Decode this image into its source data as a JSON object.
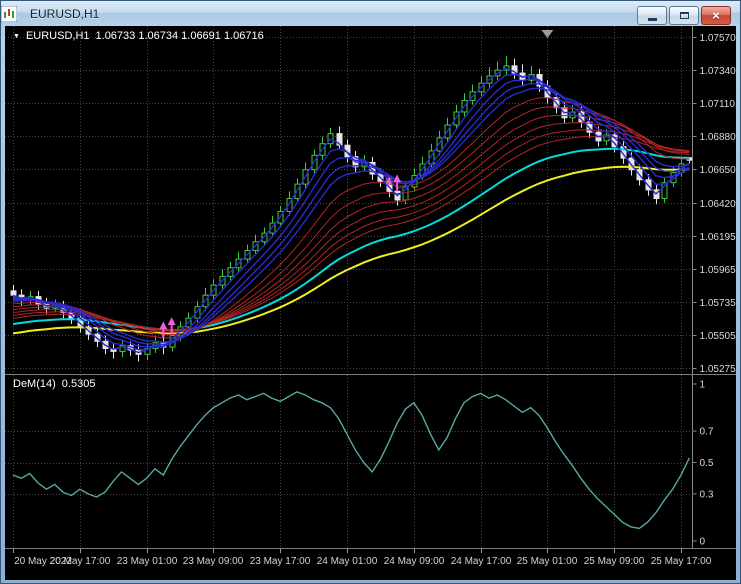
{
  "window": {
    "title": "EURUSD,H1"
  },
  "chart_data": {
    "type": "candlestick",
    "symbol_timeframe_label": "EURUSD,H1",
    "ohlc_label": "1.06733 1.06734 1.06691 1.06716",
    "background": "#000000",
    "grid_color": "#454545",
    "bull_color": "#3ecb3e",
    "bear_color": "#e6e6e6",
    "shift_marker_index": 64,
    "price_axis": {
      "top_value": 1.0757,
      "bottom_value": 1.05275,
      "ticks": [
        "1.07570",
        "1.07340",
        "1.07110",
        "1.06880",
        "1.06650",
        "1.06420",
        "1.06195",
        "1.05965",
        "1.05735",
        "1.05505",
        "1.05275"
      ]
    },
    "time_axis": {
      "candles_per_label": 8,
      "labels": [
        "20 May 2022",
        "20 May 17:00",
        "23 May 01:00",
        "23 May 09:00",
        "23 May 17:00",
        "24 May 01:00",
        "24 May 09:00",
        "24 May 17:00",
        "25 May 01:00",
        "25 May 09:00",
        "25 May 17:00"
      ]
    },
    "candles": [
      [
        1.0581,
        1.0585,
        1.0574,
        1.0578
      ],
      [
        1.0578,
        1.0582,
        1.0571,
        1.0575
      ],
      [
        1.0575,
        1.0581,
        1.0571,
        1.0577
      ],
      [
        1.0577,
        1.0581,
        1.0568,
        1.0572
      ],
      [
        1.0572,
        1.0576,
        1.0565,
        1.0569
      ],
      [
        1.0569,
        1.0575,
        1.0566,
        1.0571
      ],
      [
        1.0571,
        1.0574,
        1.0562,
        1.0566
      ],
      [
        1.0566,
        1.057,
        1.0558,
        1.0562
      ],
      [
        1.0562,
        1.0565,
        1.0552,
        1.0556
      ],
      [
        1.0556,
        1.056,
        1.0547,
        1.0551
      ],
      [
        1.0551,
        1.0555,
        1.0542,
        1.0546
      ],
      [
        1.0546,
        1.055,
        1.0537,
        1.0541
      ],
      [
        1.0541,
        1.0545,
        1.0534,
        1.0539
      ],
      [
        1.0539,
        1.0547,
        1.0535,
        1.0543
      ],
      [
        1.0543,
        1.0546,
        1.0536,
        1.054
      ],
      [
        1.054,
        1.0544,
        1.0532,
        1.0537
      ],
      [
        1.0537,
        1.0545,
        1.0533,
        1.0541
      ],
      [
        1.0541,
        1.055,
        1.0538,
        1.0545
      ],
      [
        1.0545,
        1.0548,
        1.0537,
        1.0542
      ],
      [
        1.0542,
        1.0554,
        1.0539,
        1.055
      ],
      [
        1.055,
        1.056,
        1.0546,
        1.0556
      ],
      [
        1.0556,
        1.0566,
        1.0553,
        1.0562
      ],
      [
        1.0562,
        1.0574,
        1.0559,
        1.057
      ],
      [
        1.057,
        1.0583,
        1.0567,
        1.0578
      ],
      [
        1.0578,
        1.0589,
        1.0574,
        1.0585
      ],
      [
        1.0585,
        1.0596,
        1.0582,
        1.0591
      ],
      [
        1.0591,
        1.0601,
        1.0588,
        1.0597
      ],
      [
        1.0597,
        1.0608,
        1.0594,
        1.0603
      ],
      [
        1.0603,
        1.0613,
        1.06,
        1.0609
      ],
      [
        1.0609,
        1.062,
        1.0606,
        1.0615
      ],
      [
        1.0615,
        1.0625,
        1.0612,
        1.0621
      ],
      [
        1.0621,
        1.0633,
        1.0618,
        1.0628
      ],
      [
        1.0628,
        1.064,
        1.0625,
        1.0636
      ],
      [
        1.0636,
        1.065,
        1.0633,
        1.0645
      ],
      [
        1.0645,
        1.0659,
        1.0642,
        1.0655
      ],
      [
        1.0655,
        1.067,
        1.0652,
        1.0665
      ],
      [
        1.0665,
        1.0679,
        1.0662,
        1.0675
      ],
      [
        1.0675,
        1.0688,
        1.0672,
        1.0683
      ],
      [
        1.0683,
        1.0694,
        1.068,
        1.069
      ],
      [
        1.069,
        1.0695,
        1.0679,
        1.0682
      ],
      [
        1.0682,
        1.0686,
        1.067,
        1.0674
      ],
      [
        1.0674,
        1.0678,
        1.0663,
        1.0667
      ],
      [
        1.0667,
        1.0675,
        1.0664,
        1.067
      ],
      [
        1.067,
        1.0674,
        1.0658,
        1.0662
      ],
      [
        1.0662,
        1.0666,
        1.0653,
        1.0657
      ],
      [
        1.0657,
        1.0661,
        1.0646,
        1.065
      ],
      [
        1.065,
        1.0654,
        1.064,
        1.0644
      ],
      [
        1.0644,
        1.0657,
        1.0641,
        1.0653
      ],
      [
        1.0653,
        1.0666,
        1.065,
        1.0661
      ],
      [
        1.0661,
        1.0674,
        1.0658,
        1.0669
      ],
      [
        1.0669,
        1.0683,
        1.0666,
        1.0678
      ],
      [
        1.0678,
        1.0692,
        1.0675,
        1.0687
      ],
      [
        1.0687,
        1.0701,
        1.0684,
        1.0696
      ],
      [
        1.0696,
        1.071,
        1.0693,
        1.0705
      ],
      [
        1.0705,
        1.0718,
        1.0702,
        1.0713
      ],
      [
        1.0713,
        1.0724,
        1.071,
        1.0719
      ],
      [
        1.0719,
        1.073,
        1.0716,
        1.0725
      ],
      [
        1.0725,
        1.0736,
        1.0722,
        1.073
      ],
      [
        1.073,
        1.074,
        1.0727,
        1.0734
      ],
      [
        1.0734,
        1.0744,
        1.0731,
        1.0737
      ],
      [
        1.0737,
        1.0742,
        1.0728,
        1.0732
      ],
      [
        1.0732,
        1.0738,
        1.0723,
        1.0727
      ],
      [
        1.0727,
        1.0737,
        1.0724,
        1.0731
      ],
      [
        1.0731,
        1.0735,
        1.0719,
        1.0723
      ],
      [
        1.0723,
        1.0727,
        1.0711,
        1.0715
      ],
      [
        1.0715,
        1.0719,
        1.0704,
        1.0708
      ],
      [
        1.0708,
        1.0712,
        1.0697,
        1.0701
      ],
      [
        1.0701,
        1.071,
        1.0698,
        1.0705
      ],
      [
        1.0705,
        1.0709,
        1.0694,
        1.0698
      ],
      [
        1.0698,
        1.0702,
        1.0687,
        1.0691
      ],
      [
        1.0691,
        1.0695,
        1.0681,
        1.0685
      ],
      [
        1.0685,
        1.0693,
        1.0682,
        1.0689
      ],
      [
        1.0689,
        1.0692,
        1.0677,
        1.0681
      ],
      [
        1.0681,
        1.0685,
        1.0669,
        1.0673
      ],
      [
        1.0673,
        1.0677,
        1.0661,
        1.0665
      ],
      [
        1.0665,
        1.0669,
        1.0654,
        1.0658
      ],
      [
        1.0658,
        1.0662,
        1.0647,
        1.0651
      ],
      [
        1.0651,
        1.0655,
        1.0641,
        1.0645
      ],
      [
        1.0645,
        1.066,
        1.0642,
        1.0656
      ],
      [
        1.0656,
        1.0667,
        1.0653,
        1.0663
      ],
      [
        1.0663,
        1.0673,
        1.066,
        1.0669
      ],
      [
        1.06733,
        1.06734,
        1.06691,
        1.06716
      ]
    ],
    "overlays": {
      "seed_offset_per_period": -5e-05,
      "blue_ribbon": {
        "type": "ema",
        "periods": [
          2,
          4,
          6,
          8,
          10
        ],
        "color": "#2a2ad0",
        "width": 1.4
      },
      "red_ribbon": {
        "type": "ema",
        "periods": [
          14,
          18,
          22,
          26,
          30,
          34
        ],
        "color": "#b42424",
        "width": 1
      },
      "cyan_ma": {
        "type": "ema",
        "periods": [
          42
        ],
        "color": "#00dde0",
        "width": 2
      },
      "yellow_ma": {
        "type": "ema",
        "periods": [
          55
        ],
        "color": "#efef20",
        "width": 2
      }
    },
    "signals": {
      "color": "#ee5fd8",
      "up_arrows": [
        {
          "index": 18,
          "price": 1.0548
        },
        {
          "index": 19,
          "price": 1.0551
        },
        {
          "index": 46,
          "price": 1.065
        }
      ],
      "stars": [
        {
          "index": 45,
          "price": 1.0657
        }
      ]
    },
    "indicator_panel": {
      "name_label": "DeM(14)",
      "value_label": "0.5305",
      "color": "#58a8a4",
      "range": [
        0,
        1
      ],
      "levels": [
        0.3,
        0.5,
        0.7
      ],
      "axis_tick_labels": [
        "1",
        "0.7",
        "0.5",
        "0.3",
        "0"
      ],
      "axis_tick_values": [
        1,
        0.7,
        0.5,
        0.3,
        0
      ],
      "values": [
        0.42,
        0.4,
        0.43,
        0.37,
        0.33,
        0.36,
        0.31,
        0.29,
        0.33,
        0.3,
        0.28,
        0.31,
        0.38,
        0.44,
        0.4,
        0.36,
        0.4,
        0.46,
        0.42,
        0.52,
        0.6,
        0.67,
        0.74,
        0.8,
        0.85,
        0.88,
        0.91,
        0.93,
        0.9,
        0.92,
        0.94,
        0.91,
        0.89,
        0.92,
        0.95,
        0.93,
        0.9,
        0.88,
        0.85,
        0.78,
        0.68,
        0.58,
        0.5,
        0.44,
        0.52,
        0.63,
        0.75,
        0.84,
        0.88,
        0.8,
        0.68,
        0.58,
        0.66,
        0.78,
        0.88,
        0.92,
        0.94,
        0.91,
        0.93,
        0.9,
        0.86,
        0.82,
        0.85,
        0.8,
        0.72,
        0.63,
        0.55,
        0.48,
        0.4,
        0.33,
        0.27,
        0.22,
        0.17,
        0.12,
        0.09,
        0.08,
        0.12,
        0.18,
        0.26,
        0.33,
        0.42,
        0.53
      ]
    }
  }
}
